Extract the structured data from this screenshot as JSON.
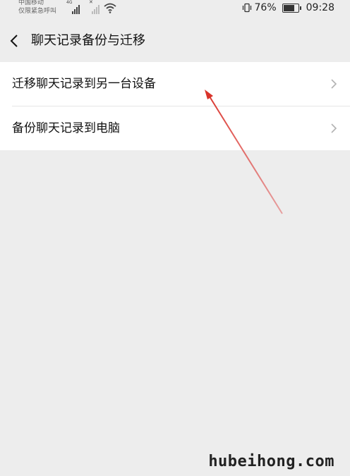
{
  "status_bar": {
    "carrier_line1": "中国移动",
    "carrier_line2": "仅限紧急呼叫",
    "network_type": "4G",
    "battery_percent": "76%",
    "battery_level": 0.76,
    "time": "09:28"
  },
  "nav": {
    "back_icon": "chevron-left-icon",
    "title": "聊天记录备份与迁移"
  },
  "list": {
    "items": [
      {
        "label": "迁移聊天记录到另一台设备",
        "icon": "chevron-right-icon"
      },
      {
        "label": "备份聊天记录到电脑",
        "icon": "chevron-right-icon"
      }
    ]
  },
  "annotation": {
    "color": "#d9332a",
    "icon": "red-arrow-icon"
  },
  "watermark": {
    "text": "hubeihong.com"
  },
  "colors": {
    "background": "#ededed",
    "card": "#ffffff"
  }
}
